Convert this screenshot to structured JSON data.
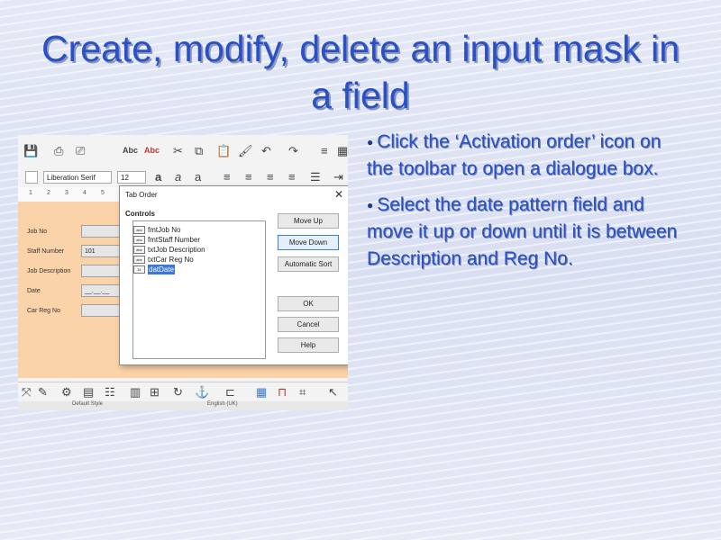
{
  "slide": {
    "title": "Create, modify, delete an input mask in a field",
    "bullets": [
      "Click the ‘Activation order’ icon on the toolbar to open a dialogue box.",
      "Select the date pattern field and move it up or down until it is between Description and Reg No."
    ]
  },
  "screenshot": {
    "font_name": "Liberation Serif",
    "font_size": "12",
    "ruler_marks": [
      "1",
      "2",
      "3",
      "4",
      "5",
      "6"
    ],
    "form": {
      "labels": [
        "Job No",
        "Staff Number",
        "Job Description",
        "Date",
        "Car Reg No"
      ],
      "staff_number_value": "101",
      "date_value": "__.__.__"
    },
    "statusbar": {
      "left": "Default Style",
      "mid": "English (UK)"
    },
    "dialog": {
      "title": "Tab Order",
      "controls_label": "Controls",
      "items": [
        "fmtJob No",
        "fmtStaff Number",
        "txtJob Description",
        "txtCar Reg No",
        "datDate"
      ],
      "selected_item": "datDate",
      "buttons": {
        "move_up": "Move Up",
        "move_down": "Move Down",
        "automatic_sort": "Automatic Sort",
        "ok": "OK",
        "cancel": "Cancel",
        "help": "Help"
      }
    }
  },
  "colors": {
    "title": "#2a50c8",
    "form_background": "#fbd3a8",
    "selection": "#3a78d8"
  }
}
